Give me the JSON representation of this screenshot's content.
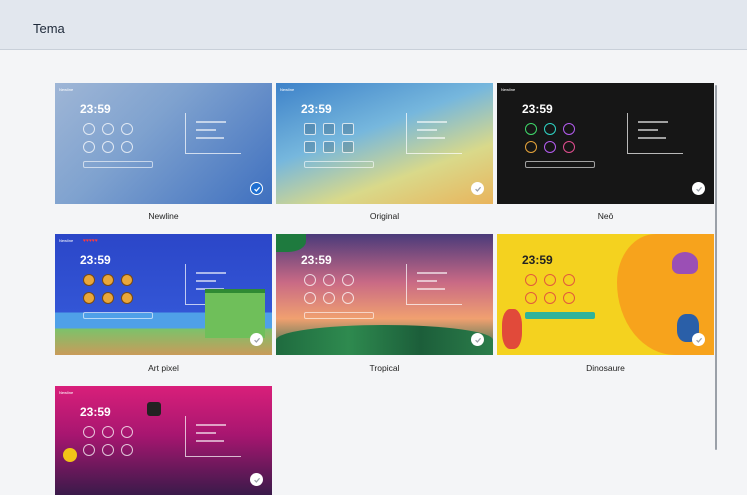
{
  "header": {
    "title": "Tema"
  },
  "themes": [
    {
      "name": "Newline",
      "clock": "23:59",
      "brand": "Newline",
      "selected": true,
      "bg": "#6a8fc7"
    },
    {
      "name": "Original",
      "clock": "23:59",
      "brand": "Newline",
      "selected": false,
      "bg": "#5aa3d8"
    },
    {
      "name": "Neō",
      "clock": "23:59",
      "brand": "Newline",
      "selected": false,
      "bg": "#141414"
    },
    {
      "name": "Art pixel",
      "clock": "23:59",
      "brand": "Newline",
      "selected": false,
      "bg": "#2b46c8"
    },
    {
      "name": "Tropical",
      "clock": "23:59",
      "brand": "",
      "selected": false,
      "bg": "#d9707a"
    },
    {
      "name": "Dinosaure",
      "clock": "23:59",
      "brand": "",
      "selected": false,
      "bg": "#f4d21f"
    },
    {
      "name": "",
      "clock": "23:59",
      "brand": "Newline",
      "selected": false,
      "bg": "#c0206e"
    }
  ]
}
